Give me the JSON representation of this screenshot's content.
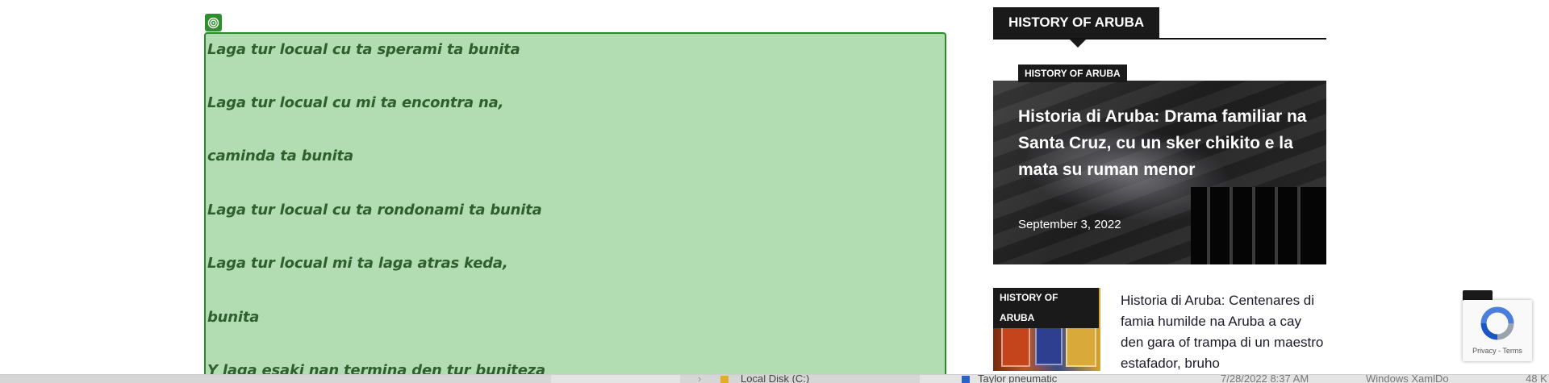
{
  "poem": {
    "lines": [
      "Laga tur locual cu ta sperami ta bunita",
      "Laga tur locual cu mi ta encontra na,",
      "caminda ta bunita",
      "Laga tur locual cu ta rondonami ta bunita",
      "Laga tur locual mi ta laga atras keda,",
      "bunita",
      "Y laga esaki nan termina den tur buniteza"
    ],
    "marker_icon": "target-icon"
  },
  "sidebar": {
    "section_title": "HISTORY OF ARUBA",
    "featured": {
      "category": "HISTORY OF ARUBA",
      "title": "Historia di Aruba: Drama familiar na Santa Cruz, cu un sker chikito e la mata su ruman menor",
      "date": "September 3, 2022"
    },
    "secondary": {
      "category": "HISTORY OF ARUBA",
      "title": "Historia di Aruba: Centenares di famia humilde na Aruba a cay den gara of trampa di un maestro estafador, bruho"
    }
  },
  "widgets": {
    "scroll_top_icon": "chevron-up-icon",
    "recaptcha_terms": "Privacy - Terms"
  },
  "taskbar": {
    "local_disk": "Local Disk (C:)",
    "app_item": "Taylor pneumatic",
    "timestamp": "7/28/2022 8:37 AM",
    "file_type": "Windows XamlDo",
    "size": "48 K"
  },
  "colors": {
    "poem_bg": "#b2dcb2",
    "poem_border": "#2a8a2a",
    "poem_text": "#2f5f2f",
    "dark": "#1a1a1a"
  }
}
